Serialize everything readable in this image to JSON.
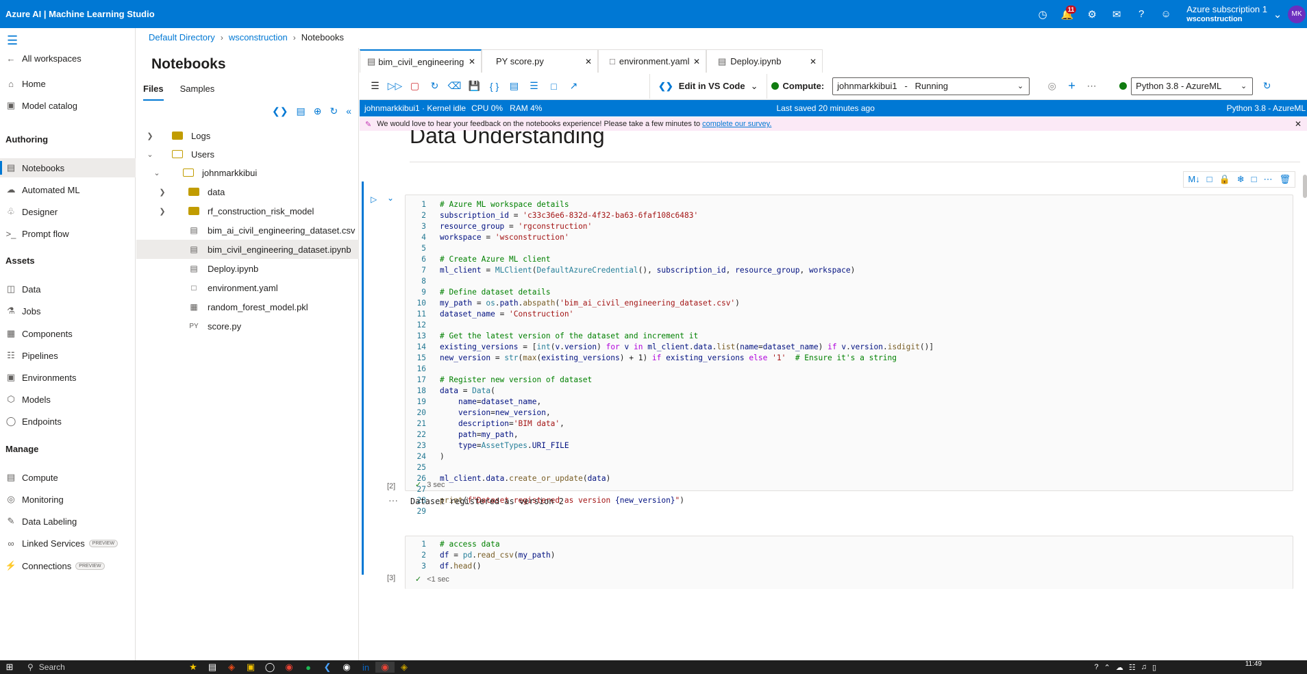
{
  "app": {
    "title": "Azure AI | Machine Learning Studio",
    "notification_count": "11",
    "subscription": "Azure subscription 1",
    "workspace": "wsconstruction",
    "avatar": "MK"
  },
  "nav": {
    "all_workspaces": "All workspaces",
    "home": "Home",
    "model_catalog": "Model catalog",
    "authoring_title": "Authoring",
    "notebooks": "Notebooks",
    "automated_ml": "Automated ML",
    "designer": "Designer",
    "prompt_flow": "Prompt flow",
    "assets_title": "Assets",
    "data": "Data",
    "jobs": "Jobs",
    "components": "Components",
    "pipelines": "Pipelines",
    "environments": "Environments",
    "models": "Models",
    "endpoints": "Endpoints",
    "manage_title": "Manage",
    "compute": "Compute",
    "monitoring": "Monitoring",
    "data_labeling": "Data Labeling",
    "linked_services": "Linked Services",
    "connections": "Connections",
    "preview": "PREVIEW"
  },
  "breadcrumb": {
    "b1": "Default Directory",
    "b2": "wsconstruction",
    "b3": "Notebooks"
  },
  "files": {
    "title": "Notebooks",
    "tab_files": "Files",
    "tab_samples": "Samples",
    "items": {
      "logs": "Logs",
      "users": "Users",
      "user": "johnmarkkibui",
      "data": "data",
      "rf_model": "rf_construction_risk_model",
      "csv": "bim_ai_civil_engineering_dataset.csv",
      "ipynb": "bim_civil_engineering_dataset.ipynb",
      "deploy": "Deploy.ipynb",
      "env": "environment.yaml",
      "pkl": "random_forest_model.pkl",
      "score": "score.py",
      "py_prefix": "PY"
    }
  },
  "tabs": {
    "t1": "bim_civil_engineering",
    "t2": "PY score.py",
    "t3": "environment.yaml",
    "t4": "Deploy.ipynb"
  },
  "toolbar": {
    "edit_vscode": "Edit in VS Code",
    "compute_label": "Compute:",
    "compute_value": "johnmarkkibui1   -   Running",
    "kernel_value": "Python 3.8 - AzureML"
  },
  "status": {
    "left": "johnmarkkibui1 · Kernel idle",
    "cpu": "CPU  0%",
    "ram": "RAM  4%",
    "saved": "Last saved 20 minutes ago",
    "kernel": "Python 3.8 - AzureML"
  },
  "feedback": {
    "text": "We would love to hear your feedback on the notebooks experience! Please take a few minutes to",
    "link": "complete our survey."
  },
  "notebook": {
    "heading": "Data Understanding",
    "cell1_exec": "[2]",
    "cell1_time": "3 sec",
    "cell1_output": "Dataset registered as version 2",
    "cell2_exec": "[3]",
    "cell2_time": "<1 sec",
    "out_dots": "···"
  },
  "taskbar": {
    "search": "Search",
    "time": "11:49"
  },
  "colors": {
    "accent": "#0078d4",
    "running": "#107c10",
    "badge": "#c50f1f"
  }
}
